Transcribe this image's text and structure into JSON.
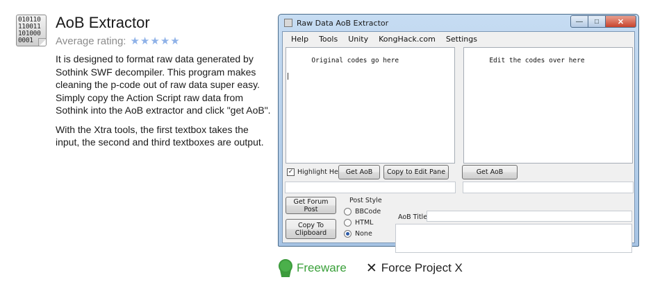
{
  "app": {
    "icon_lines": [
      "010110",
      "110011",
      "101000",
      "0001"
    ],
    "title": "AoB Extractor",
    "rating_label": "Average rating:",
    "stars": 5,
    "description": [
      "It is designed to format raw data generated by Sothink SWF decompiler. This program makes cleaning the p-code out of raw data super easy. Simply copy the Action Script raw data from Sothink into the AoB extractor and click \"get AoB\".",
      "With the Xtra tools, the first textbox takes the input, the second and third textboxes are output."
    ]
  },
  "window": {
    "title": "Raw Data AoB Extractor",
    "menu": [
      "Help",
      "Tools",
      "Unity",
      "KongHack.com",
      "Settings"
    ],
    "left_textbox_value": "Original codes go here",
    "right_textbox_value": "Edit the codes over here",
    "highlight_hex_label": "Highlight Hex",
    "highlight_hex_checked": true,
    "get_aob_left": "Get AoB",
    "copy_to_edit_pane": "Copy to Edit Pane",
    "get_aob_right": "Get AoB",
    "get_forum_post": "Get Forum Post",
    "copy_to_clipboard_line1": "Copy To",
    "copy_to_clipboard_line2": "Clipboard",
    "post_style_label": "Post Style",
    "post_style_options": [
      "BBCode",
      "HTML",
      "None"
    ],
    "post_style_selected": "None",
    "aob_title_label": "AoB Title",
    "window_controls": {
      "min": "—",
      "max": "□",
      "close": "✕"
    }
  },
  "badges": {
    "license": "Freeware",
    "author": "Force Project X"
  },
  "colors": {
    "license_green": "#3aa03a",
    "star_blue": "#8fb2e8"
  }
}
